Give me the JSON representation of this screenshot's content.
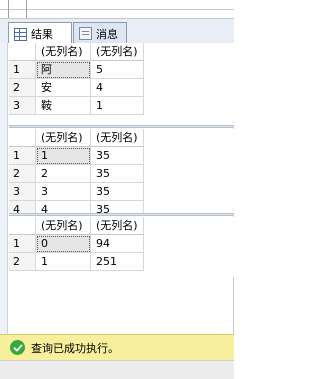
{
  "tabs": [
    {
      "label": "结果",
      "icon": "grid-icon",
      "active": true
    },
    {
      "label": "消息",
      "icon": "document-icon",
      "active": false
    }
  ],
  "grids": [
    {
      "columns": [
        "(无列名)",
        "(无列名)"
      ],
      "rows": [
        {
          "num": "1",
          "cells": [
            "阿",
            "5"
          ]
        },
        {
          "num": "2",
          "cells": [
            "安",
            "4"
          ]
        },
        {
          "num": "3",
          "cells": [
            "鞍",
            "1"
          ]
        }
      ]
    },
    {
      "columns": [
        "(无列名)",
        "(无列名)"
      ],
      "rows": [
        {
          "num": "1",
          "cells": [
            "1",
            "35"
          ]
        },
        {
          "num": "2",
          "cells": [
            "2",
            "35"
          ]
        },
        {
          "num": "3",
          "cells": [
            "3",
            "35"
          ]
        },
        {
          "num": "4",
          "cells": [
            "4",
            "35"
          ]
        }
      ]
    },
    {
      "columns": [
        "(无列名)",
        "(无列名)"
      ],
      "rows": [
        {
          "num": "1",
          "cells": [
            "0",
            "94"
          ]
        },
        {
          "num": "2",
          "cells": [
            "1",
            "251"
          ]
        }
      ]
    }
  ],
  "status": {
    "text": "查询已成功执行。",
    "icon": "success-check-icon",
    "background": "#f7ef9b"
  }
}
